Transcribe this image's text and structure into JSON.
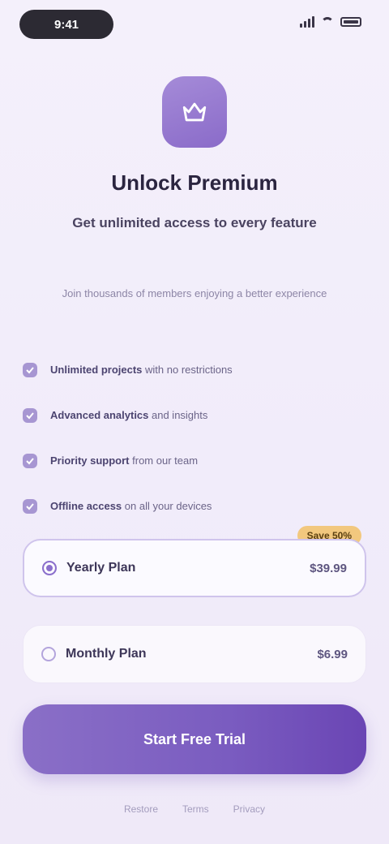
{
  "status": {
    "time": "9:41",
    "battery": "100"
  },
  "hero": {
    "title": "Unlock Premium",
    "subtitle": "Get unlimited access to every feature",
    "description": "Join thousands of members enjoying a better experience"
  },
  "features": [
    {
      "bold": "Unlimited projects",
      "rest": " with no restrictions"
    },
    {
      "bold": "Advanced analytics",
      "rest": " and insights"
    },
    {
      "bold": "Priority support",
      "rest": " from our team"
    },
    {
      "bold": "Offline access",
      "rest": " on all your devices"
    }
  ],
  "plans": {
    "yearly": {
      "label": "Yearly Plan",
      "price": "$39.99",
      "badge": "Save 50%"
    },
    "monthly": {
      "label": "Monthly Plan",
      "price": "$6.99"
    }
  },
  "cta": {
    "label": "Start Free Trial"
  },
  "footer": {
    "restore": "Restore",
    "terms": "Terms",
    "privacy": "Privacy"
  }
}
